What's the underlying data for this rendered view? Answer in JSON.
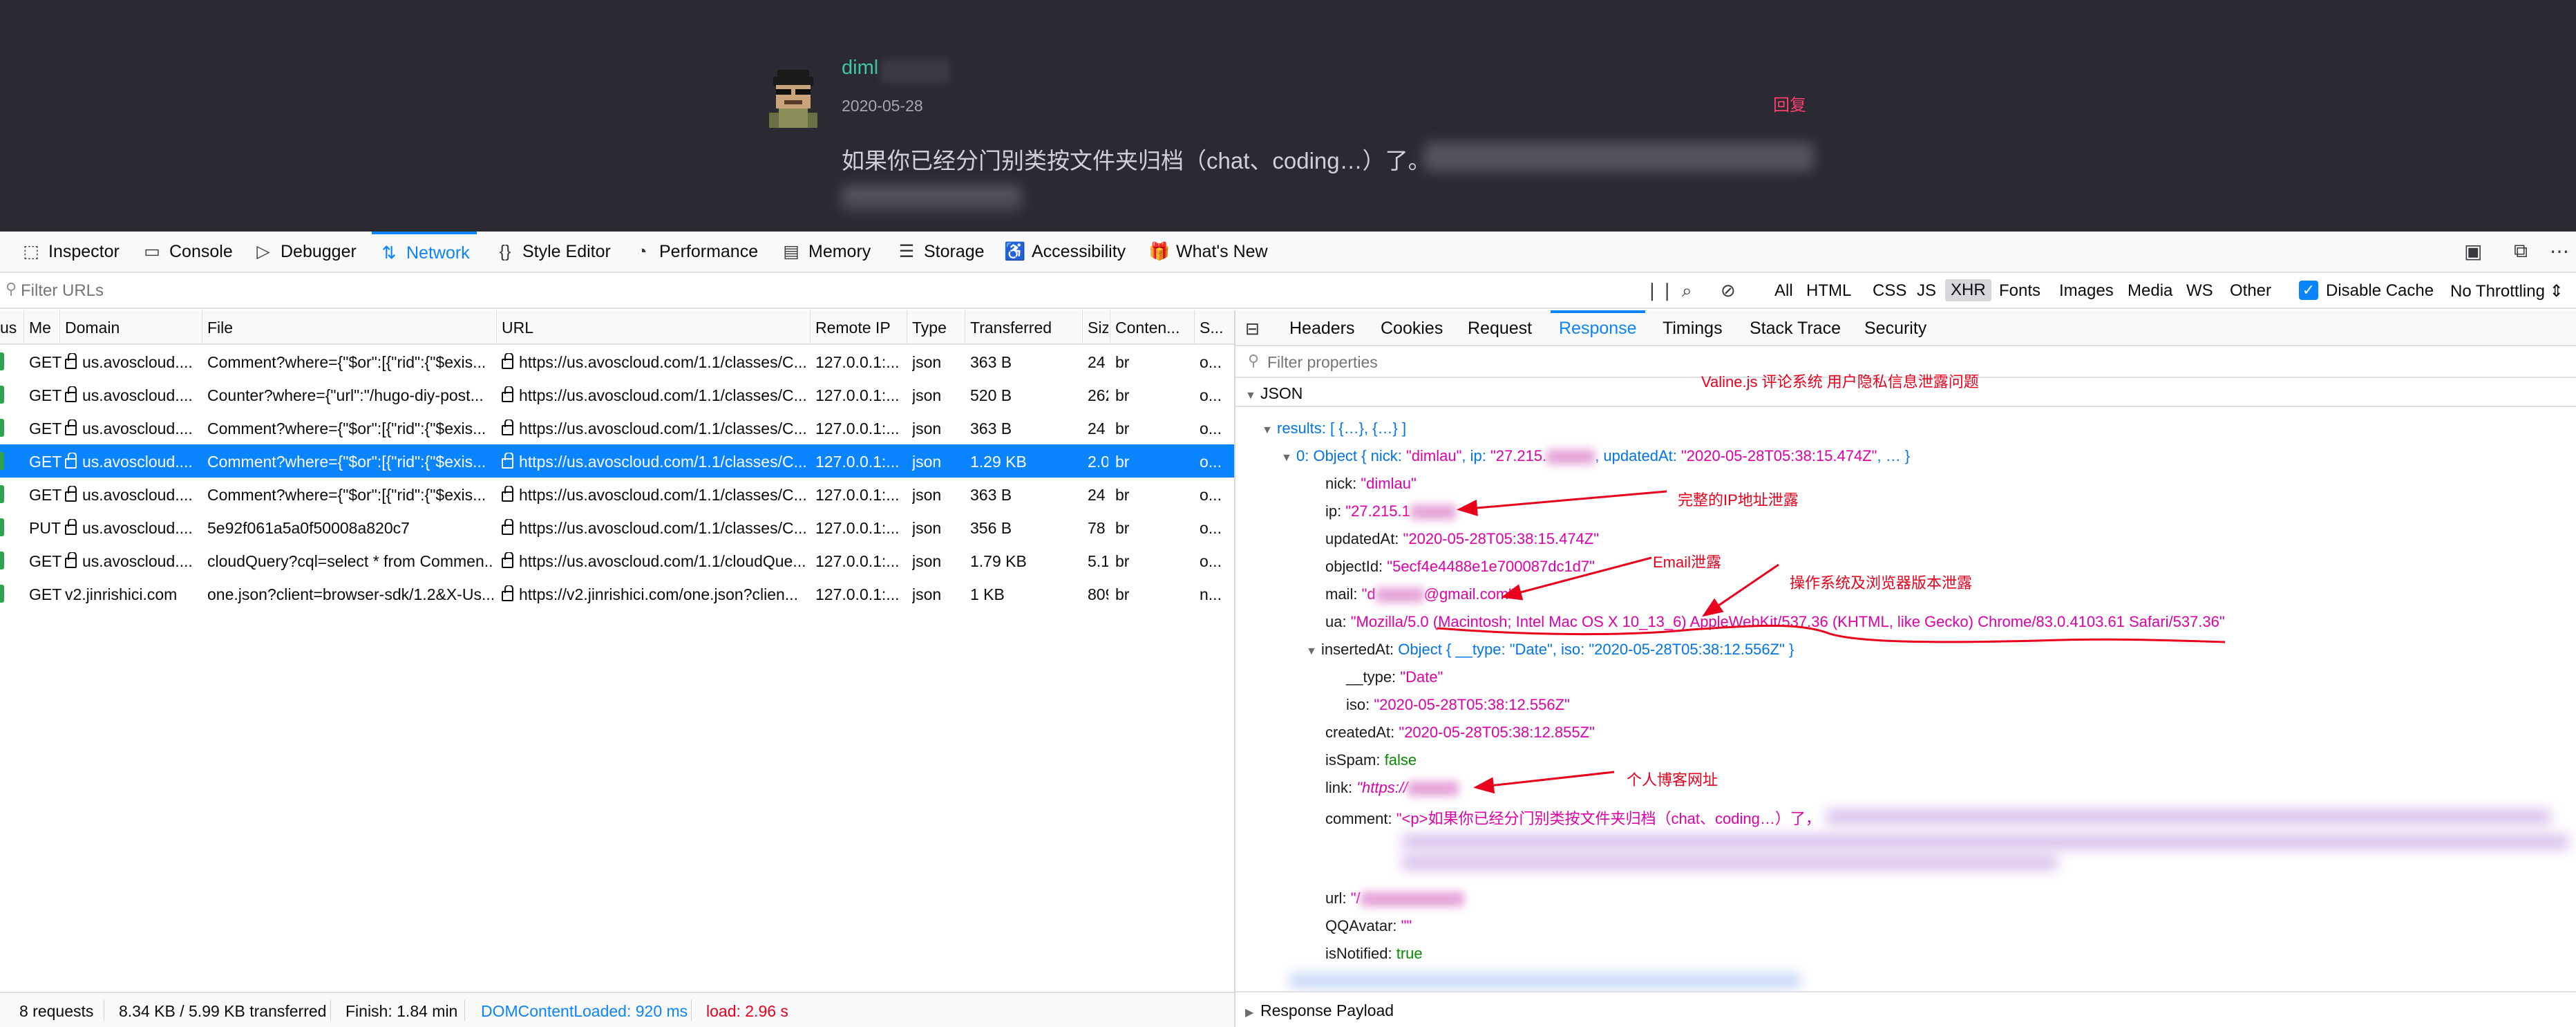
{
  "webpage": {
    "username": "diml",
    "date": "2020-05-28",
    "reply": "回复",
    "comment": "如果你已经分门别类按文件夹归档（chat、coding…）了。"
  },
  "toolbar": {
    "tabs": [
      {
        "label": "Inspector",
        "icon": "inspector-icon"
      },
      {
        "label": "Console",
        "icon": "console-icon"
      },
      {
        "label": "Debugger",
        "icon": "debugger-icon"
      },
      {
        "label": "Network",
        "icon": "network-icon"
      },
      {
        "label": "Style Editor",
        "icon": "style-editor-icon"
      },
      {
        "label": "Performance",
        "icon": "performance-icon"
      },
      {
        "label": "Memory",
        "icon": "memory-icon"
      },
      {
        "label": "Storage",
        "icon": "storage-icon"
      },
      {
        "label": "Accessibility",
        "icon": "accessibility-icon"
      },
      {
        "label": "What's New",
        "icon": "gift-icon"
      }
    ],
    "active_tab": "Network",
    "accent": "#0a84ff"
  },
  "filter": {
    "placeholder": "Filter URLs",
    "types": [
      "All",
      "HTML",
      "CSS",
      "JS",
      "XHR",
      "Fonts",
      "Images",
      "Media",
      "WS",
      "Other"
    ],
    "selected_type": "XHR",
    "disable_cache_label": "Disable Cache",
    "disable_cache_checked": true,
    "throttling": "No Throttling"
  },
  "table": {
    "columns": [
      "us",
      "Me",
      "Domain",
      "File",
      "URL",
      "Remote IP",
      "Type",
      "Transferred",
      "Siz",
      "Conten...",
      "S..."
    ],
    "rows": [
      {
        "method": "GET",
        "domain": "us.avoscloud....",
        "file": "Comment?where={\"$or\":[{\"rid\":{\"$exis...",
        "url": "https://us.avoscloud.com/1.1/classes/C...",
        "ip": "127.0.0.1:...",
        "type": "json",
        "transferred": "363 B",
        "size": "24",
        "content": "br",
        "s": "o..."
      },
      {
        "method": "GET",
        "domain": "us.avoscloud....",
        "file": "Counter?where={\"url\":\"/hugo-diy-post...",
        "url": "https://us.avoscloud.com/1.1/classes/C...",
        "ip": "127.0.0.1:...",
        "type": "json",
        "transferred": "520 B",
        "size": "262",
        "content": "br",
        "s": "o..."
      },
      {
        "method": "GET",
        "domain": "us.avoscloud....",
        "file": "Comment?where={\"$or\":[{\"rid\":{\"$exis...",
        "url": "https://us.avoscloud.com/1.1/classes/C...",
        "ip": "127.0.0.1:...",
        "type": "json",
        "transferred": "363 B",
        "size": "24",
        "content": "br",
        "s": "o..."
      },
      {
        "method": "GET",
        "domain": "us.avoscloud....",
        "file": "Comment?where={\"$or\":[{\"rid\":{\"$exis...",
        "url": "https://us.avoscloud.com/1.1/classes/C...",
        "ip": "127.0.0.1:...",
        "type": "json",
        "transferred": "1.29 KB",
        "size": "2.0",
        "content": "br",
        "s": "o..."
      },
      {
        "method": "GET",
        "domain": "us.avoscloud....",
        "file": "Comment?where={\"$or\":[{\"rid\":{\"$exis...",
        "url": "https://us.avoscloud.com/1.1/classes/C...",
        "ip": "127.0.0.1:...",
        "type": "json",
        "transferred": "363 B",
        "size": "24",
        "content": "br",
        "s": "o..."
      },
      {
        "method": "PUT",
        "domain": "us.avoscloud....",
        "file": "5e92f061a5a0f50008a820c7",
        "url": "https://us.avoscloud.com/1.1/classes/C...",
        "ip": "127.0.0.1:...",
        "type": "json",
        "transferred": "356 B",
        "size": "78",
        "content": "br",
        "s": "o..."
      },
      {
        "method": "GET",
        "domain": "us.avoscloud....",
        "file": "cloudQuery?cql=select * from Commen...",
        "url": "https://us.avoscloud.com/1.1/cloudQue...",
        "ip": "127.0.0.1:...",
        "type": "json",
        "transferred": "1.79 KB",
        "size": "5.1",
        "content": "br",
        "s": "o..."
      },
      {
        "method": "GET",
        "domain": "v2.jinrishici.com",
        "file": "one.json?client=browser-sdk/1.2&X-Us...",
        "url": "https://v2.jinrishici.com/one.json?clien...",
        "ip": "127.0.0.1:...",
        "type": "json",
        "transferred": "1 KB",
        "size": "809",
        "content": "br",
        "s": "n..."
      }
    ],
    "selected_row": 3
  },
  "status": {
    "requests": "8 requests",
    "transferred": "8.34 KB / 5.99 KB transferred",
    "finish": "Finish: 1.84 min",
    "dcl": "DOMContentLoaded: 920 ms",
    "load": "load: 2.96 s",
    "dcl_color": "#0a84ff",
    "load_color": "#e8001c"
  },
  "details": {
    "tabs": [
      "Headers",
      "Cookies",
      "Request",
      "Response",
      "Timings",
      "Stack Trace",
      "Security"
    ],
    "active_tab": "Response",
    "filter_placeholder": "Filter properties",
    "json_label": "JSON",
    "response_payload": "Response Payload"
  },
  "json": {
    "results": "results: [ {…}, {…} ]",
    "obj0_prefix": "0: Object { nick: ",
    "obj0_nick": "\"dimlau\"",
    "obj0_ip_key": ", ip: ",
    "obj0_ip": "\"27.215.",
    "obj0_updated_key": ", updatedAt: ",
    "obj0_updated": "\"2020-05-28T05:38:15.474Z\"",
    "obj0_suffix": ", … }",
    "nick_key": "nick: ",
    "nick": "\"dimlau\"",
    "ip_key": "ip: ",
    "ip": "\"27.215.1",
    "updated_key": "updatedAt: ",
    "updated": "\"2020-05-28T05:38:15.474Z\"",
    "objectid_key": "objectId: ",
    "objectid": "\"5ecf4e4488e1e700087dc1d7\"",
    "mail_key": "mail: ",
    "mail_pre": "\"d",
    "mail_post": "@gmail.com\"",
    "ua_key": "ua: ",
    "ua": "\"Mozilla/5.0 (Macintosh; Intel Mac OS X 10_13_6) AppleWebKit/537.36 (KHTML, like Gecko) Chrome/83.0.4103.61 Safari/537.36\"",
    "inserted_key": "insertedAt: ",
    "inserted": "Object { __type: \"Date\", iso: \"2020-05-28T05:38:12.556Z\" }",
    "type_key": "__type: ",
    "type_val": "\"Date\"",
    "iso_key": "iso: ",
    "iso_val": "\"2020-05-28T05:38:12.556Z\"",
    "created_key": "createdAt: ",
    "created": "\"2020-05-28T05:38:12.855Z\"",
    "isspam_key": "isSpam: ",
    "isspam": "false",
    "link_key": "link: ",
    "link": "\"https://",
    "comment_key": "comment: ",
    "comment": "\"<p>如果你已经分门别类按文件夹归档（chat、coding…）了，",
    "url_key": "url: ",
    "url": "\"/",
    "qq_key": "QQAvatar: ",
    "qq": "\"\"",
    "notified_key": "isNotified: ",
    "notified": "true"
  },
  "annotations": {
    "title": "Valine.js 评论系统 用户隐私信息泄露问题",
    "ip": "完整的IP地址泄露",
    "email": "Email泄露",
    "ua": "操作系统及浏览器版本泄露",
    "link": "个人博客网址",
    "color": "#e8001c"
  }
}
